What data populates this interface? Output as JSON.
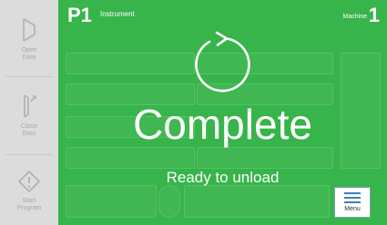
{
  "sidebar": {
    "open_door": {
      "line1": "Open",
      "line2": "Door"
    },
    "close_door": {
      "line1": "Close",
      "line2": "Door"
    },
    "start_program": {
      "line1": "Start",
      "line2": "Program"
    }
  },
  "header": {
    "chamber": "P1",
    "chamber_label": "Instrument",
    "machine_label": "Machine",
    "machine_number": "1"
  },
  "status": {
    "title": "Complete",
    "subtitle": "Ready to unload"
  },
  "menu": {
    "label": "Menu"
  },
  "colors": {
    "panel": "#37b44a",
    "accent": "#3a7fc1"
  }
}
